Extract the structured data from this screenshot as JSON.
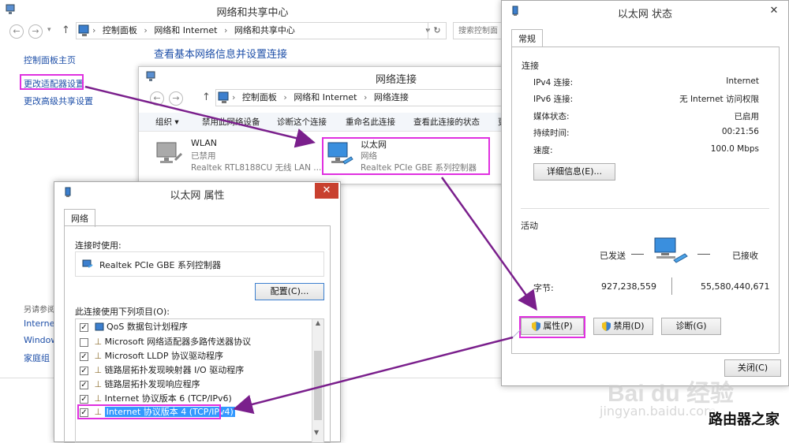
{
  "network_center": {
    "title": "网络和共享中心",
    "breadcrumb": [
      "控制面板",
      "网络和 Internet",
      "网络和共享中心"
    ],
    "search_placeholder": "搜索控制面",
    "left_links": [
      "控制面板主页",
      "更改适配器设置",
      "更改高级共享设置"
    ],
    "see_also_heading": "另请参阅",
    "see_also_items": [
      "Internet",
      "Window",
      "家庭组"
    ],
    "heading": "查看基本网络信息并设置连接"
  },
  "network_connections": {
    "title": "网络连接",
    "breadcrumb": [
      "控制面板",
      "网络和 Internet",
      "网络连接"
    ],
    "toolbar": [
      "组织 ▾",
      "禁用此网络设备",
      "诊断这个连接",
      "重命名此连接",
      "查看此连接的状态",
      "更"
    ],
    "adapters": [
      {
        "name": "WLAN",
        "status": "已禁用",
        "device": "Realtek RTL8188CU 无线 LAN ..."
      },
      {
        "name": "以太网",
        "status": "网络",
        "device": "Realtek PCIe GBE 系列控制器"
      }
    ]
  },
  "properties": {
    "title": "以太网 属性",
    "tab": "网络",
    "connect_using_label": "连接时使用:",
    "adapter": "Realtek PCIe GBE 系列控制器",
    "configure_button": "配置(C)...",
    "items_label": "此连接使用下列项目(O):",
    "items": [
      {
        "label": "QoS 数据包计划程序",
        "checked": "✓"
      },
      {
        "label": "Microsoft 网络适配器多路传送器协议",
        "checked": ""
      },
      {
        "label": "Microsoft LLDP 协议驱动程序",
        "checked": "✓"
      },
      {
        "label": "链路层拓扑发现映射器 I/O 驱动程序",
        "checked": "✓"
      },
      {
        "label": "链路层拓扑发现响应程序",
        "checked": "✓"
      },
      {
        "label": "Internet 协议版本 6 (TCP/IPv6)",
        "checked": "✓"
      },
      {
        "label": "Internet 协议版本 4 (TCP/IPv4)",
        "checked": "✓"
      }
    ]
  },
  "status": {
    "title": "以太网 状态",
    "tab": "常规",
    "connection_heading": "连接",
    "rows": [
      {
        "label": "IPv4 连接:",
        "value": "Internet"
      },
      {
        "label": "IPv6 连接:",
        "value": "无 Internet 访问权限"
      },
      {
        "label": "媒体状态:",
        "value": "已启用"
      },
      {
        "label": "持续时间:",
        "value": "00:21:56"
      },
      {
        "label": "速度:",
        "value": "100.0 Mbps"
      }
    ],
    "details_button": "详细信息(E)...",
    "activity_heading": "活动",
    "sent_label": "已发送",
    "received_label": "已接收",
    "bytes_label": "字节:",
    "bytes_sent": "927,238,559",
    "bytes_received": "55,580,440,671",
    "properties_button": "属性(P)",
    "disable_button": "禁用(D)",
    "diagnose_button": "诊断(G)",
    "close_button": "关闭(C)"
  },
  "watermark": {
    "brand": "Bai du 经验",
    "sub": "jingyan.baidu.com",
    "site": "路由器之家"
  },
  "colors": {
    "highlight": "#e030e0",
    "arrow": "#7a1f8c",
    "link": "#1e4fa8",
    "selection": "#3399ff"
  }
}
